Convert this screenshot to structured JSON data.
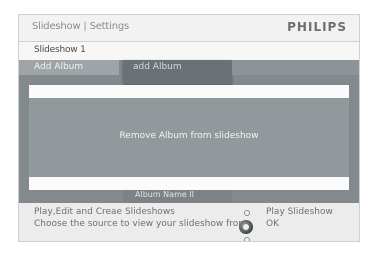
{
  "header": {
    "breadcrumb": "Slideshow | Settings",
    "brand": "PHILIPS"
  },
  "subtitle": "Slideshow 1",
  "tabs": {
    "left": "Add Album",
    "middle": "add Album"
  },
  "main": {
    "center_text": "Remove Album from slideshow",
    "bottom_label": "Album Name II"
  },
  "footer": {
    "line1": "Play,Edit and Creae Slideshows",
    "line2": "Choose the source to view your slideshow from",
    "play_label": "Play Slideshow",
    "ok_label": "OK"
  },
  "icons": {
    "dial": "navigation-dial-icon"
  },
  "colors": {
    "panel": "#828a8e",
    "tab_active": "#6b7276",
    "header_bg": "#f2f2f2"
  }
}
